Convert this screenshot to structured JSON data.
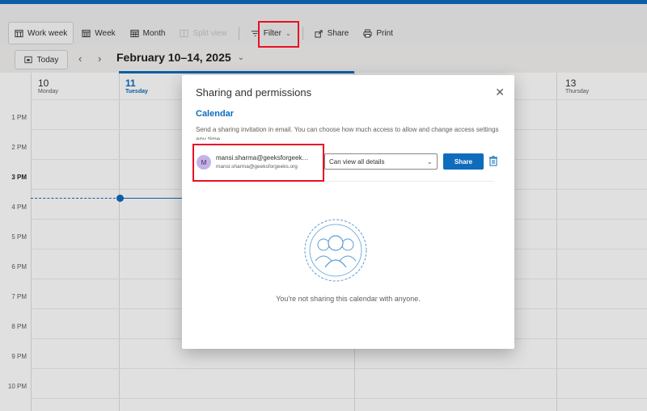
{
  "toolbar": {
    "items": [
      {
        "label": "Work week",
        "icon": "work-week-icon"
      },
      {
        "label": "Week",
        "icon": "week-icon"
      },
      {
        "label": "Month",
        "icon": "month-icon"
      },
      {
        "label": "Split view",
        "icon": "split-view-icon"
      },
      {
        "label": "Filter",
        "icon": "filter-icon"
      },
      {
        "label": "Share",
        "icon": "share-icon"
      },
      {
        "label": "Print",
        "icon": "print-icon"
      }
    ]
  },
  "nav": {
    "today_label": "Today",
    "date_range": "February 10–14, 2025"
  },
  "calendar": {
    "days": [
      {
        "num": "10",
        "name": "Monday"
      },
      {
        "num": "11",
        "name": "Tuesday"
      },
      {
        "num": "13",
        "name": "Thursday"
      }
    ],
    "hours": [
      "1 PM",
      "2 PM",
      "3 PM",
      "4 PM",
      "5 PM",
      "6 PM",
      "7 PM",
      "8 PM",
      "9 PM",
      "10 PM"
    ]
  },
  "dialog": {
    "title": "Sharing and permissions",
    "section": "Calendar",
    "description": "Send a sharing invitation in email. You can choose how much access to allow and change access settings any time.",
    "avatar_initial": "M",
    "email_display": "mansi.sharma@geeksforgeeks.o...",
    "email_sub": "mansi.sharma@geeksforgeeks.org",
    "permission": "Can view all details",
    "share_label": "Share",
    "empty_message": "You're not sharing this calendar with anyone."
  },
  "colors": {
    "accent": "#0f6cbd",
    "highlight": "#e81123"
  }
}
